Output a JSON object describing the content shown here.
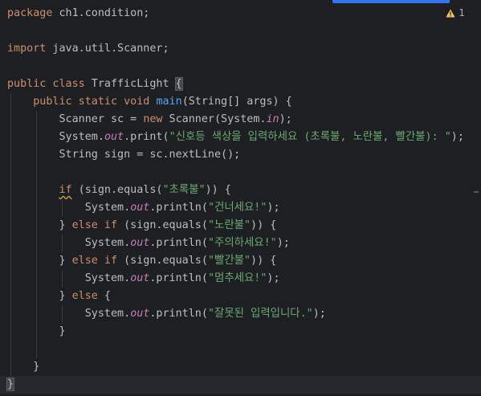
{
  "editor": {
    "inspection": {
      "count": "1",
      "icon": "warning-triangle-icon",
      "color": "#f2c55c"
    },
    "colors": {
      "background": "#1e1f22",
      "keyword": "#cf8e6d",
      "string": "#6aab73",
      "method": "#56a8f5",
      "field": "#c77dbb",
      "text": "#bcbec4"
    },
    "lines": [
      [
        {
          "t": "package",
          "c": "kw"
        },
        {
          "t": " ch1.condition;",
          "c": "plain"
        }
      ],
      [],
      [
        {
          "t": "import",
          "c": "kw"
        },
        {
          "t": " java.util.Scanner;",
          "c": "plain"
        }
      ],
      [],
      [
        {
          "t": "public class",
          "c": "kw"
        },
        {
          "t": " TrafficLight ",
          "c": "plain"
        },
        {
          "t": "{",
          "c": "plain",
          "brace": true
        }
      ],
      [
        {
          "t": "    "
        },
        {
          "t": "public static void",
          "c": "kw"
        },
        {
          "t": " ",
          "c": "plain"
        },
        {
          "t": "main",
          "c": "fn"
        },
        {
          "t": "(String[] args) {",
          "c": "plain"
        }
      ],
      [
        {
          "t": "        "
        },
        {
          "t": "Scanner sc = ",
          "c": "plain"
        },
        {
          "t": "new",
          "c": "kw"
        },
        {
          "t": " Scanner(System.",
          "c": "plain"
        },
        {
          "t": "in",
          "c": "fld"
        },
        {
          "t": ");",
          "c": "plain"
        }
      ],
      [
        {
          "t": "        "
        },
        {
          "t": "System.",
          "c": "plain"
        },
        {
          "t": "out",
          "c": "fld"
        },
        {
          "t": ".print(",
          "c": "plain"
        },
        {
          "t": "\"신호등 색상을 입력하세요 (초록불, 노란불, 빨간불): \"",
          "c": "str"
        },
        {
          "t": ");",
          "c": "plain"
        }
      ],
      [
        {
          "t": "        "
        },
        {
          "t": "String sign = sc.nextLine();",
          "c": "plain"
        }
      ],
      [],
      [
        {
          "t": "        "
        },
        {
          "t": "if",
          "c": "kw",
          "warn": true
        },
        {
          "t": " (sign.equals(",
          "c": "plain"
        },
        {
          "t": "\"초록불\"",
          "c": "str"
        },
        {
          "t": ")) {",
          "c": "plain"
        }
      ],
      [
        {
          "t": "            "
        },
        {
          "t": "System.",
          "c": "plain"
        },
        {
          "t": "out",
          "c": "fld"
        },
        {
          "t": ".println(",
          "c": "plain"
        },
        {
          "t": "\"건너세요!\"",
          "c": "str"
        },
        {
          "t": ");",
          "c": "plain"
        }
      ],
      [
        {
          "t": "        "
        },
        {
          "t": "} ",
          "c": "plain"
        },
        {
          "t": "else if",
          "c": "kw"
        },
        {
          "t": " (sign.equals(",
          "c": "plain"
        },
        {
          "t": "\"노란불\"",
          "c": "str"
        },
        {
          "t": ")) {",
          "c": "plain"
        }
      ],
      [
        {
          "t": "            "
        },
        {
          "t": "System.",
          "c": "plain"
        },
        {
          "t": "out",
          "c": "fld"
        },
        {
          "t": ".println(",
          "c": "plain"
        },
        {
          "t": "\"주의하세요!\"",
          "c": "str"
        },
        {
          "t": ");",
          "c": "plain"
        }
      ],
      [
        {
          "t": "        "
        },
        {
          "t": "} ",
          "c": "plain"
        },
        {
          "t": "else if",
          "c": "kw"
        },
        {
          "t": " (sign.equals(",
          "c": "plain"
        },
        {
          "t": "\"빨간불\"",
          "c": "str"
        },
        {
          "t": ")) {",
          "c": "plain"
        }
      ],
      [
        {
          "t": "            "
        },
        {
          "t": "System.",
          "c": "plain"
        },
        {
          "t": "out",
          "c": "fld"
        },
        {
          "t": ".println(",
          "c": "plain"
        },
        {
          "t": "\"멈추세요!\"",
          "c": "str"
        },
        {
          "t": ");",
          "c": "plain"
        }
      ],
      [
        {
          "t": "        "
        },
        {
          "t": "} ",
          "c": "plain"
        },
        {
          "t": "else",
          "c": "kw"
        },
        {
          "t": " {",
          "c": "plain"
        }
      ],
      [
        {
          "t": "            "
        },
        {
          "t": "System.",
          "c": "plain"
        },
        {
          "t": "out",
          "c": "fld"
        },
        {
          "t": ".println(",
          "c": "plain"
        },
        {
          "t": "\"잘못된 입력입니다.\"",
          "c": "str"
        },
        {
          "t": ");",
          "c": "plain"
        }
      ],
      [
        {
          "t": "        "
        },
        {
          "t": "}",
          "c": "plain"
        }
      ],
      [],
      [
        {
          "t": "    "
        },
        {
          "t": "}",
          "c": "plain"
        }
      ],
      [
        {
          "t": "}",
          "c": "plain",
          "brace": true
        }
      ]
    ]
  }
}
